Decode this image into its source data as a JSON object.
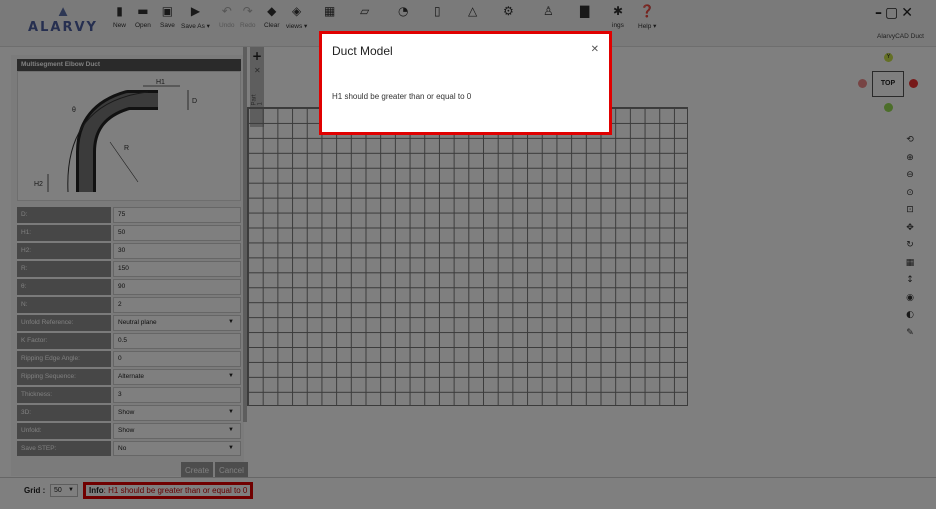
{
  "app": {
    "name": "AlarvyCAD Duct",
    "logo_text": "ALARVY"
  },
  "toolbar": {
    "buttons": [
      {
        "label": "New"
      },
      {
        "label": "Open"
      },
      {
        "label": "Save"
      },
      {
        "label": "Save As ▾"
      },
      {
        "label": "Undo"
      },
      {
        "label": "Redo"
      },
      {
        "label": "Clear"
      },
      {
        "label": "views ▾"
      },
      {
        "label": "ings"
      },
      {
        "label": "Help ▾"
      }
    ]
  },
  "panel": {
    "title": "Multisegment Elbow Duct",
    "diagram_labels": {
      "h1": "H1",
      "d": "D",
      "theta": "θ",
      "r": "R",
      "h2": "H2"
    },
    "fields": [
      {
        "label": "D:",
        "value": "75"
      },
      {
        "label": "H1:",
        "value": "50"
      },
      {
        "label": "H2:",
        "value": "30"
      },
      {
        "label": "R:",
        "value": "150"
      },
      {
        "label": "θ:",
        "value": "90"
      },
      {
        "label": "N:",
        "value": "2"
      },
      {
        "label": "Unfold Reference:",
        "value": "Neutral plane",
        "dropdown": true
      },
      {
        "label": "K Factor:",
        "value": "0.5"
      },
      {
        "label": "Ripping Edge Angle:",
        "value": "0"
      },
      {
        "label": "Ripping Sequence:",
        "value": "Alternate",
        "dropdown": true
      },
      {
        "label": "Thickness:",
        "value": "3"
      },
      {
        "label": "3D:",
        "value": "Show",
        "dropdown": true
      },
      {
        "label": "Unfold:",
        "value": "Show",
        "dropdown": true
      },
      {
        "label": "Save STEP:",
        "value": "No",
        "dropdown": true
      }
    ],
    "create_label": "Create",
    "cancel_label": "Cancel"
  },
  "part_tab": {
    "label": "Part 1"
  },
  "viewcube": {
    "face": "TOP",
    "top_axis": "Y"
  },
  "modal": {
    "title": "Duct Model",
    "message": "H1 should be greater than or equal to 0"
  },
  "status": {
    "grid_label": "Grid :",
    "grid_value": "50",
    "info_label": "Info",
    "info_message": ": H1 should be greater than or equal to 0"
  },
  "colors": {
    "highlight": "#e00000",
    "accent": "#4d5fa0"
  }
}
